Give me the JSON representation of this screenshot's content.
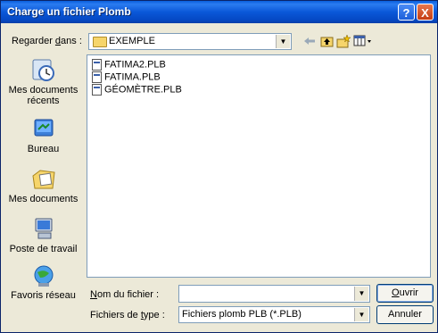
{
  "dialog": {
    "title": "Charge un fichier Plomb",
    "help_glyph": "?",
    "close_glyph": "X"
  },
  "lookin": {
    "label_pre": "Regarder ",
    "label_access": "d",
    "label_post": "ans :",
    "value": "EXEMPLE"
  },
  "toolbar": {
    "back_icon": "back-arrow-icon",
    "up_icon": "up-folder-icon",
    "new_folder_icon": "new-folder-icon",
    "view_icon": "view-menu-icon"
  },
  "places": [
    {
      "label": "Mes documents récents",
      "icon": "recent-documents-icon"
    },
    {
      "label": "Bureau",
      "icon": "desktop-icon"
    },
    {
      "label": "Mes documents",
      "icon": "my-documents-icon"
    },
    {
      "label": "Poste de travail",
      "icon": "my-computer-icon"
    },
    {
      "label": "Favoris réseau",
      "icon": "network-places-icon"
    }
  ],
  "files": [
    {
      "name": "FATIMA2.PLB"
    },
    {
      "name": "FATIMA.PLB"
    },
    {
      "name": "GÉOMÈTRE.PLB"
    }
  ],
  "filename": {
    "label_access": "N",
    "label_rest": "om du fichier :",
    "value": ""
  },
  "filetype": {
    "label_pre": "Fichiers de ",
    "label_access": "t",
    "label_post": "ype :",
    "value": "Fichiers plomb PLB (*.PLB)"
  },
  "buttons": {
    "open_access": "O",
    "open_rest": "uvrir",
    "cancel": "Annuler"
  },
  "colors": {
    "titlebar": "#0a58d8",
    "dialog_bg": "#ece9d8"
  }
}
